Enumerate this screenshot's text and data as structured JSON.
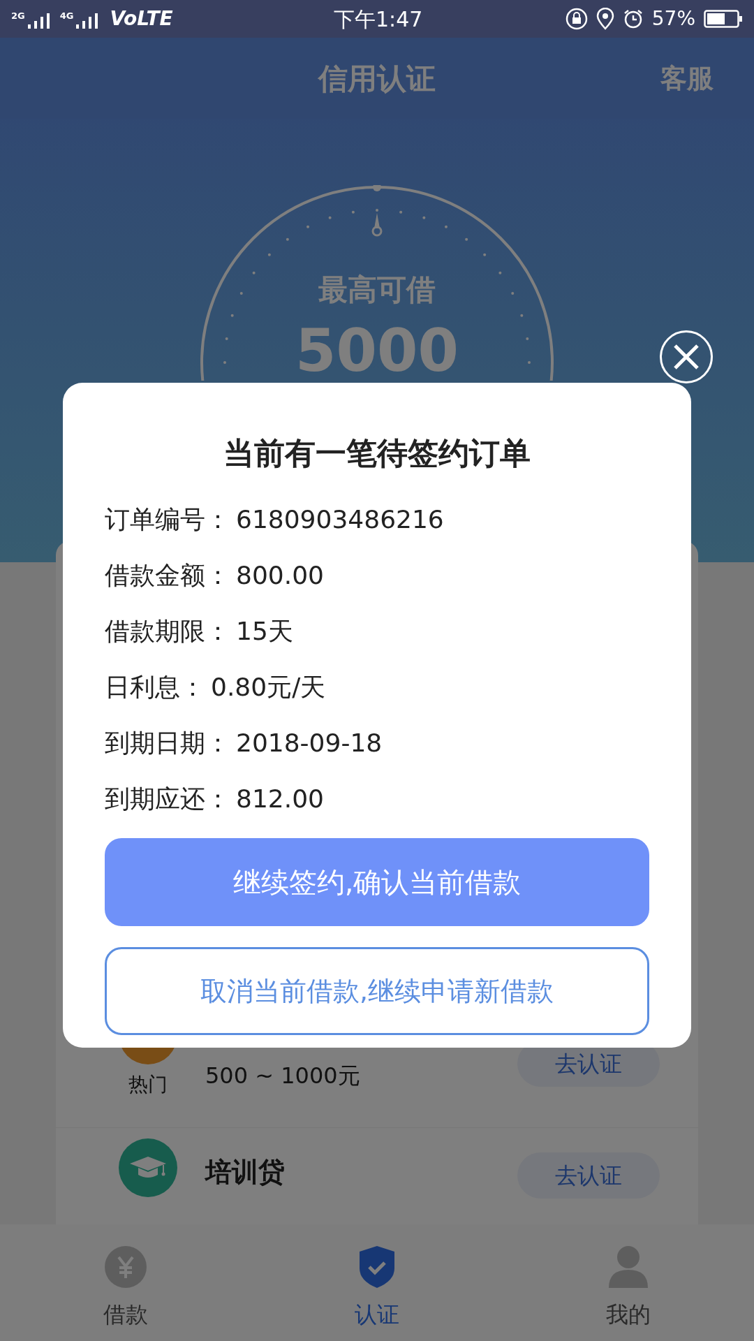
{
  "status_bar": {
    "network_1": "2G",
    "network_2": "4G",
    "carrier": "VoLTE",
    "time": "下午1:47",
    "battery": "57%"
  },
  "header": {
    "title": "信用认证",
    "action": "客服"
  },
  "gauge": {
    "label": "最高可借",
    "amount": "5000"
  },
  "products": [
    {
      "kind": "hot",
      "badge": "热门",
      "range": "500 ~ 1000元",
      "button": "去认证"
    },
    {
      "kind": "training",
      "title": "培训贷",
      "button": "去认证"
    }
  ],
  "tabs": [
    {
      "kind": "yuan",
      "label": "借款",
      "selected": false
    },
    {
      "kind": "shield",
      "label": "认证",
      "selected": true
    },
    {
      "kind": "person",
      "label": "我的",
      "selected": false
    }
  ],
  "dialog": {
    "title": "当前有一笔待签约订单",
    "fields": [
      {
        "label": "订单编号：",
        "value": "6180903486216"
      },
      {
        "label": "借款金额：",
        "value": "800.00"
      },
      {
        "label": "借款期限：",
        "value": "15天"
      },
      {
        "label": "日利息：",
        "value": "0.80元/天"
      },
      {
        "label": "到期日期：",
        "value": "2018-09-18"
      },
      {
        "label": "到期应还：",
        "value": "812.00"
      }
    ],
    "primary_button": "继续签约,确认当前借款",
    "secondary_button": "取消当前借款,继续申请新借款"
  }
}
